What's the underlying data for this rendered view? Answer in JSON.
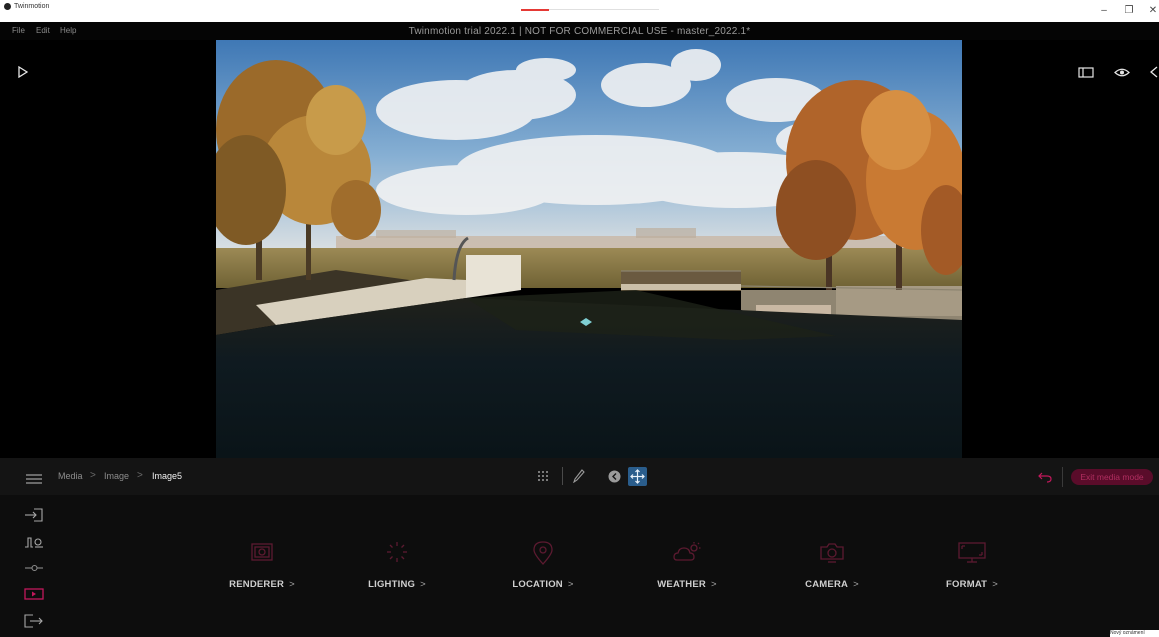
{
  "os_window": {
    "app_name": "Twinmotion",
    "minimize": "–",
    "restore": "❐",
    "close": "✕"
  },
  "menu": {
    "items": [
      "File",
      "Edit",
      "Help"
    ],
    "title": "Twinmotion trial 2022.1 | NOT FOR COMMERCIAL USE - master_2022.1*"
  },
  "viewport": {
    "play_icon": "play-icon",
    "right_icons": [
      "panel-toggle-icon",
      "eye-icon",
      "collapse-left-icon"
    ]
  },
  "toolbar": {
    "menu_icon": "hamburger-icon",
    "breadcrumbs": [
      "Media",
      "Image",
      "Image5"
    ],
    "breadcrumb_separator": ">",
    "center_icons": [
      "grid-icon",
      "pen-icon",
      "back-circle-icon",
      "move-icon"
    ],
    "exit_label": "Exit media mode",
    "accent_color": "#c2185b",
    "active_tool_color": "#2a5d8c"
  },
  "side_panel": {
    "icons": [
      "import-icon",
      "context-icon",
      "configure-icon",
      "media-icon",
      "export-icon"
    ],
    "active_index": 3
  },
  "categories": [
    {
      "label": "RENDERER",
      "icon": "renderer-icon"
    },
    {
      "label": "LIGHTING",
      "icon": "lighting-icon"
    },
    {
      "label": "LOCATION",
      "icon": "location-pin-icon"
    },
    {
      "label": "WEATHER",
      "icon": "weather-icon"
    },
    {
      "label": "CAMERA",
      "icon": "camera-icon"
    },
    {
      "label": "FORMAT",
      "icon": "format-icon"
    }
  ],
  "chevron": ">",
  "tooltip": "Nový oznámení"
}
